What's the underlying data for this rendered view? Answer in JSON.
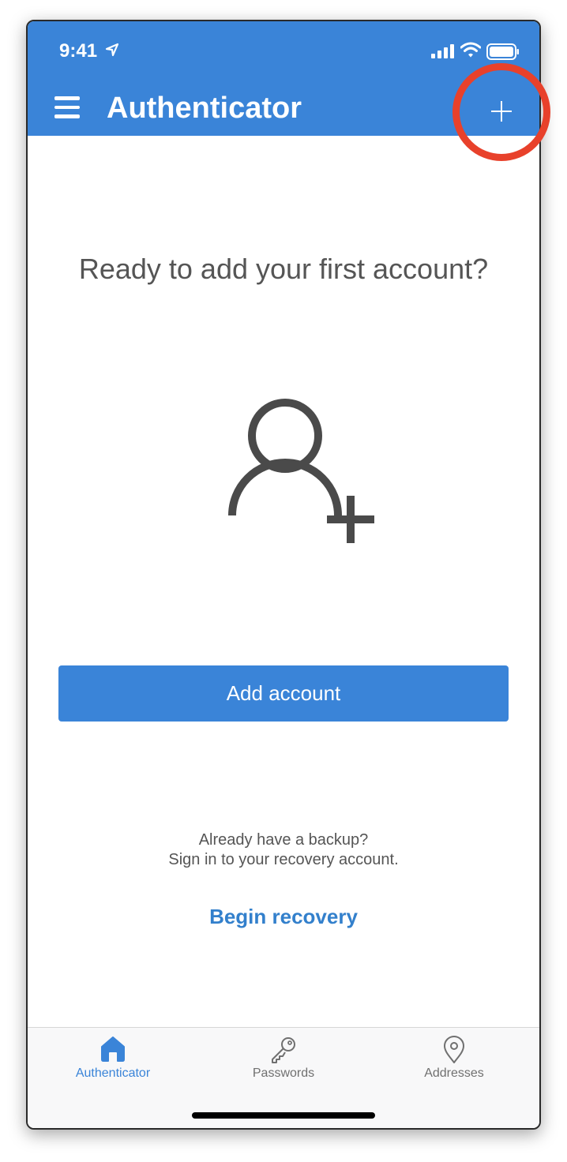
{
  "status_bar": {
    "time": "9:41",
    "location_icon": "location-arrow-icon",
    "signal_icon": "cellular-signal-icon",
    "wifi_icon": "wifi-icon",
    "battery_icon": "battery-full-icon"
  },
  "header": {
    "title": "Authenticator",
    "menu_icon": "hamburger-menu-icon",
    "add_icon": "plus-icon",
    "background_color": "#3a84d8"
  },
  "main": {
    "headline": "Ready to add your first account?",
    "illustration_icon": "add-person-icon",
    "add_account_label": "Add account",
    "backup_line1": "Already have a backup?",
    "backup_line2": "Sign in to your recovery account.",
    "recovery_link": "Begin recovery"
  },
  "tabbar": {
    "items": [
      {
        "label": "Authenticator",
        "icon": "home-icon",
        "active": true
      },
      {
        "label": "Passwords",
        "icon": "key-icon",
        "active": false
      },
      {
        "label": "Addresses",
        "icon": "map-pin-icon",
        "active": false
      }
    ]
  },
  "annotation": {
    "highlight_color": "#e8412b",
    "highlight_target": "plus-icon"
  }
}
